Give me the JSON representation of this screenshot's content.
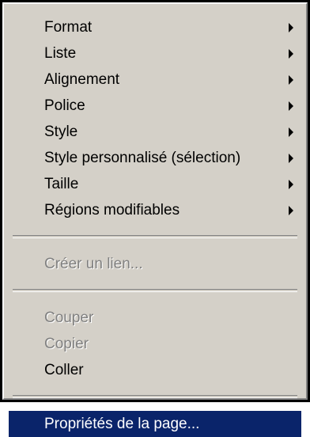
{
  "menu": {
    "groups": [
      [
        {
          "label": "Format",
          "submenu": true,
          "enabled": true
        },
        {
          "label": "Liste",
          "submenu": true,
          "enabled": true
        },
        {
          "label": "Alignement",
          "submenu": true,
          "enabled": true
        },
        {
          "label": "Police",
          "submenu": true,
          "enabled": true
        },
        {
          "label": "Style",
          "submenu": true,
          "enabled": true
        },
        {
          "label": "Style personnalisé (sélection)",
          "submenu": true,
          "enabled": true
        },
        {
          "label": "Taille",
          "submenu": true,
          "enabled": true
        },
        {
          "label": "Régions modifiables",
          "submenu": true,
          "enabled": true
        }
      ],
      [
        {
          "label": "Créer un lien...",
          "submenu": false,
          "enabled": false
        }
      ],
      [
        {
          "label": "Couper",
          "submenu": false,
          "enabled": false
        },
        {
          "label": "Copier",
          "submenu": false,
          "enabled": false
        },
        {
          "label": "Coller",
          "submenu": false,
          "enabled": true
        }
      ],
      [
        {
          "label": "Propriétés de la page...",
          "submenu": false,
          "enabled": true,
          "selected": true
        }
      ]
    ]
  },
  "colors": {
    "menu_background": "#d4d0c8",
    "selection_background": "#0a246a",
    "selection_text": "#ffffff",
    "disabled_text": "#808080"
  }
}
